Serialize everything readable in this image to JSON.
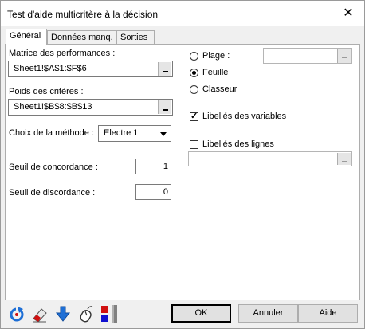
{
  "window": {
    "title": "Test d'aide multicritère à la décision"
  },
  "tabs": [
    "Général",
    "Données manq.",
    "Sorties"
  ],
  "general": {
    "performances_label": "Matrice des performances :",
    "performances_value": "Sheet1!$A$1:$F$6",
    "poids_label": "Poids des critères :",
    "poids_value": "Sheet1!$B$8:$B$13",
    "methode_label": "Choix de la méthode :",
    "methode_value": "Electre 1",
    "concordance_label": "Seuil de concordance :",
    "concordance_value": "1",
    "discordance_label": "Seuil de discordance :",
    "discordance_value": "0"
  },
  "output_options": {
    "plage_label": "Plage :",
    "feuille_label": "Feuille",
    "classeur_label": "Classeur",
    "selected": "Feuille",
    "plage_value": ""
  },
  "variables": {
    "libelles_variables_label": "Libellés des variables",
    "libelles_variables_checked": true,
    "libelles_lignes_label": "Libellés des lignes",
    "libelles_lignes_checked": false,
    "libelles_lignes_value": ""
  },
  "buttons": {
    "ok": "OK",
    "annuler": "Annuler",
    "aide": "Aide"
  },
  "toolbar_icons": [
    "reset-icon",
    "eraser-icon",
    "down-arrow-icon",
    "mouse-icon",
    "color-swatch-icon"
  ],
  "colors": {
    "accent_blue": "#1e6fd6",
    "red": "#d01010",
    "blue": "#1010d0"
  }
}
